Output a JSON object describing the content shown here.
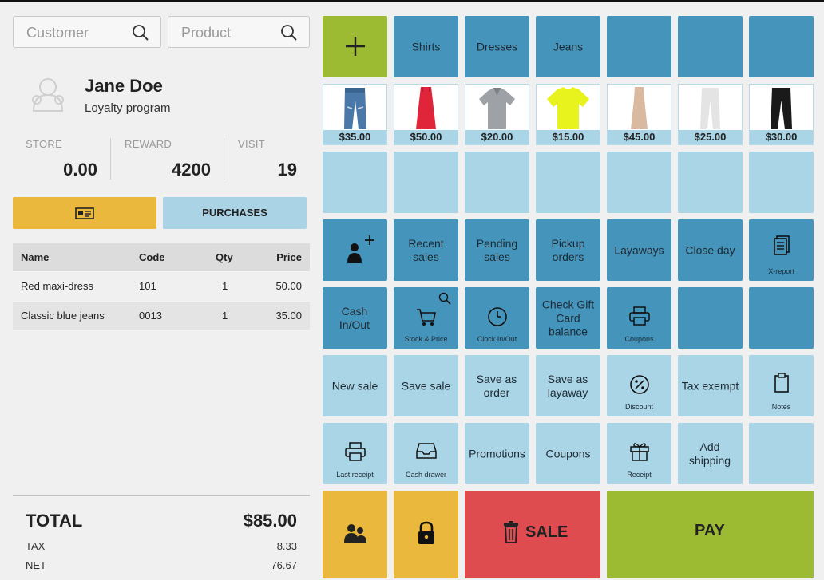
{
  "search": {
    "customer_placeholder": "Customer",
    "product_placeholder": "Product"
  },
  "customer": {
    "name": "Jane Doe",
    "program": "Loyalty program"
  },
  "stats": [
    {
      "label": "STORE",
      "value": "0.00"
    },
    {
      "label": "REWARD",
      "value": "4200"
    },
    {
      "label": "VISIT",
      "value": "19"
    }
  ],
  "buttons": {
    "purchases": "PURCHASES"
  },
  "table": {
    "headers": [
      "Name",
      "Code",
      "Qty",
      "Price"
    ],
    "rows": [
      [
        "Red maxi-dress",
        "101",
        "1",
        "50.00"
      ],
      [
        "Classic blue jeans",
        "0013",
        "1",
        "35.00"
      ]
    ]
  },
  "totals": {
    "total_label": "TOTAL",
    "total_value": "$85.00",
    "tax_label": "TAX",
    "tax_value": "8.33",
    "net_label": "NET",
    "net_value": "76.67"
  },
  "categories": [
    "Shirts",
    "Dresses",
    "Jeans"
  ],
  "products": [
    {
      "price": "$35.00",
      "icon": "blue-jeans-icon"
    },
    {
      "price": "$50.00",
      "icon": "red-dress-icon"
    },
    {
      "price": "$20.00",
      "icon": "grey-polo-shirt-icon"
    },
    {
      "price": "$15.00",
      "icon": "yellow-tshirt-icon"
    },
    {
      "price": "$45.00",
      "icon": "beige-dress-icon"
    },
    {
      "price": "$25.00",
      "icon": "white-pants-icon"
    },
    {
      "price": "$30.00",
      "icon": "black-pants-icon"
    }
  ],
  "actions": {
    "recent_sales": "Recent sales",
    "pending_sales": "Pending sales",
    "pickup_orders": "Pickup orders",
    "layaways": "Layaways",
    "close_day": "Close day",
    "x_report": "X-report",
    "cash_in_out": "Cash In/Out",
    "stock_price": "Stock & Price",
    "clock_in_out": "Clock In/Out",
    "gift_card": "Check Gift Card balance",
    "coupons_small": "Coupons",
    "new_sale": "New sale",
    "save_sale": "Save sale",
    "save_order": "Save as order",
    "save_layaway": "Save as layaway",
    "discount": "Discount",
    "tax_exempt": "Tax exempt",
    "notes": "Notes",
    "last_receipt": "Last receipt",
    "cash_drawer": "Cash drawer",
    "promotions": "Promotions",
    "coupons": "Coupons",
    "receipt": "Receipt",
    "add_shipping": "Add shipping",
    "sale": "SALE",
    "pay": "PAY"
  },
  "colors": {
    "dark_blue": "#4594bb",
    "light_blue": "#a9d5e7",
    "green": "#9cba32",
    "yellow": "#e9b83d",
    "red": "#de4c4f"
  }
}
